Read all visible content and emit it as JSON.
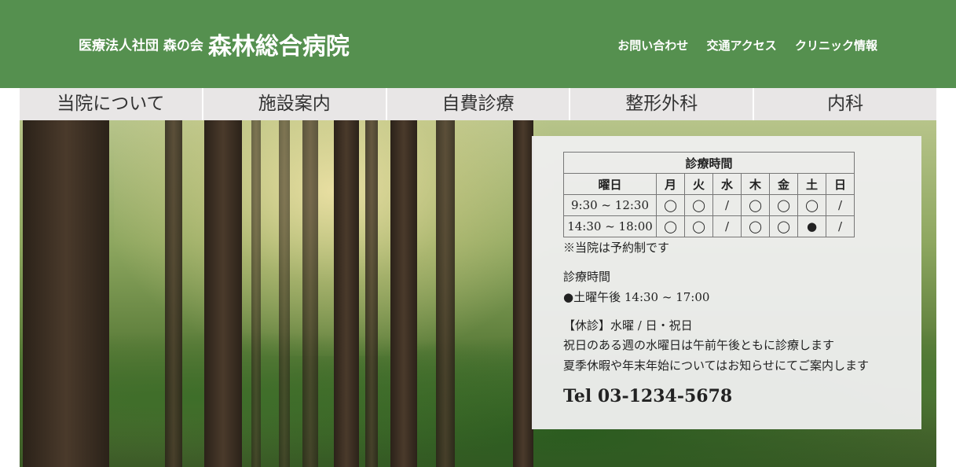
{
  "header": {
    "org": "医療法人社団 森の会",
    "name": "森林総合病院",
    "links": [
      "お問い合わせ",
      "交通アクセス",
      "クリニック情報"
    ]
  },
  "nav": [
    "当院について",
    "施設案内",
    "自費診療",
    "整形外科",
    "内科"
  ],
  "hours": {
    "title": "診療時間",
    "day_header": "曜日",
    "days": [
      "月",
      "火",
      "水",
      "木",
      "金",
      "土",
      "日"
    ],
    "rows": [
      {
        "time": "9:30 ~ 12:30",
        "cells": [
          "◯",
          "◯",
          "/",
          "◯",
          "◯",
          "◯",
          "/"
        ]
      },
      {
        "time": "14:30 ~ 18:00",
        "cells": [
          "◯",
          "◯",
          "/",
          "◯",
          "◯",
          "●",
          "/"
        ]
      }
    ],
    "reservation_note": "※当院は予約制です",
    "subtitle": "診療時間",
    "saturday_note": "●土曜午後 14:30 ~ 17:00",
    "closed": "【休診】水曜 / 日・祝日",
    "holiday_note": "祝日のある週の水曜日は午前午後ともに診療します",
    "vacation_note": "夏季休暇や年末年始についてはお知らせにてご案内します",
    "tel": "Tel 03-1234-5678"
  },
  "colors": {
    "header_bg": "#55904f",
    "nav_bg": "#e8e6e6"
  }
}
